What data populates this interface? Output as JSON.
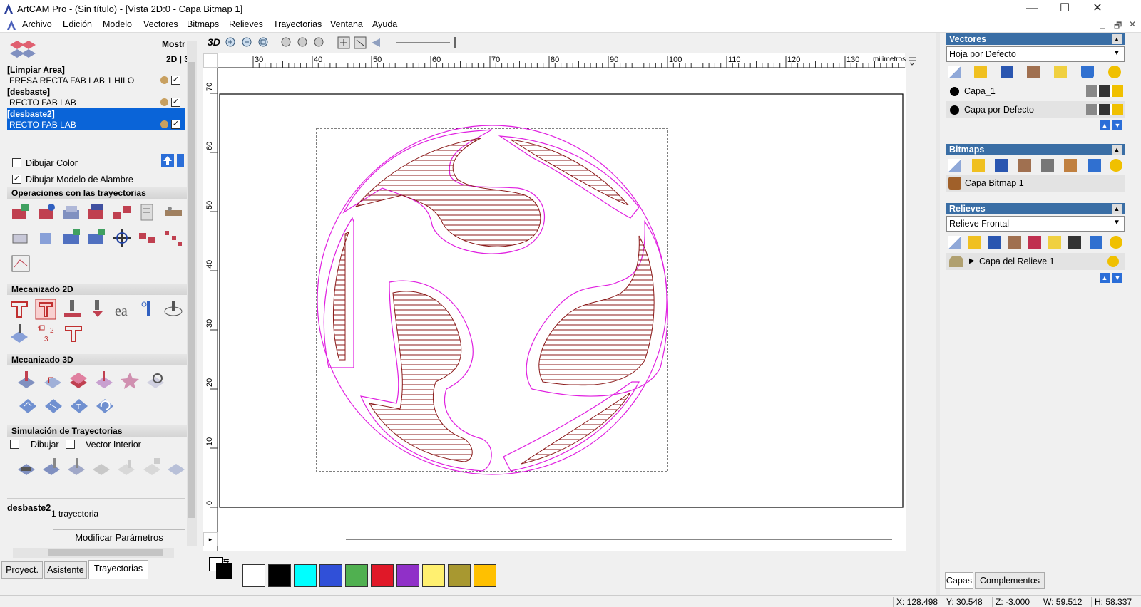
{
  "window": {
    "title": "ArtCAM Pro - (Sin título) - [Vista 2D:0 - Capa Bitmap 1]",
    "controls": {
      "minimize": "—",
      "maximize": "☐",
      "close": "✕"
    }
  },
  "menu": {
    "items": [
      "Archivo",
      "Edición",
      "Modelo",
      "Vectores",
      "Bitmaps",
      "Relieves",
      "Trayectorias",
      "Ventana",
      "Ayuda"
    ],
    "mdi_controls": [
      "_",
      "🗗",
      "✕"
    ]
  },
  "left_panel": {
    "header_labels": {
      "show": "Mostr",
      "mode": "2D | 3"
    },
    "toolpaths": [
      {
        "group": "[Limpiar Area]",
        "tool": "FRESA RECTA FAB LAB 1 HILO",
        "selected": false
      },
      {
        "group": "[desbaste]",
        "tool": "RECTO FAB LAB",
        "selected": false
      },
      {
        "group": "[desbaste2]",
        "tool": "RECTO FAB LAB",
        "selected": true
      }
    ],
    "draw_color": {
      "label": "Dibujar Color",
      "checked": false
    },
    "draw_wireframe": {
      "label": "Dibujar Modelo de Alambre",
      "checked": true
    },
    "sections": {
      "ops": "Operaciones con las trayectorias",
      "m2d": "Mecanizado 2D",
      "m3d": "Mecanizado 3D",
      "sim": "Simulación de Trayectorias"
    },
    "sim_options": {
      "draw": "Dibujar",
      "inner": "Vector Interior"
    },
    "selected_info": {
      "name": "desbaste2",
      "count": "1 trayectoria"
    },
    "modify_button": "Modificar Parámetros",
    "tabs": [
      "Proyect.",
      "Asistente",
      "Trayectorias"
    ],
    "active_tab": "Trayectorias"
  },
  "view": {
    "toolbar_3d": "3D",
    "ruler_unit": "milímetros",
    "h_ticks": [
      "30",
      "40",
      "50",
      "60",
      "70",
      "80",
      "90",
      "100",
      "110",
      "120",
      "130"
    ],
    "v_ticks": [
      "70",
      "60",
      "50",
      "40",
      "30",
      "20",
      "10",
      "0"
    ]
  },
  "palette": {
    "colors": [
      "#ffffff",
      "#000000",
      "#00ffff",
      "#3050d8",
      "#50b050",
      "#e01828",
      "#9030c8",
      "#fff070",
      "#a89830",
      "#ffc000"
    ]
  },
  "right_panel": {
    "vectors": {
      "title": "Vectores",
      "sheet": "Hoja por Defecto",
      "layers": [
        "Capa_1",
        "Capa por Defecto"
      ]
    },
    "bitmaps": {
      "title": "Bitmaps",
      "layers": [
        "Capa Bitmap 1"
      ]
    },
    "reliefs": {
      "title": "Relieves",
      "combo": "Relieve Frontal",
      "layers": [
        "Capa del Relieve 1"
      ]
    },
    "tabs": [
      "Capas",
      "Complementos"
    ]
  },
  "status": {
    "x": "X: 128.498",
    "y": "Y: 30.548",
    "z": "Z: -3.000",
    "w": "W: 59.512",
    "h": "H: 58.337"
  }
}
